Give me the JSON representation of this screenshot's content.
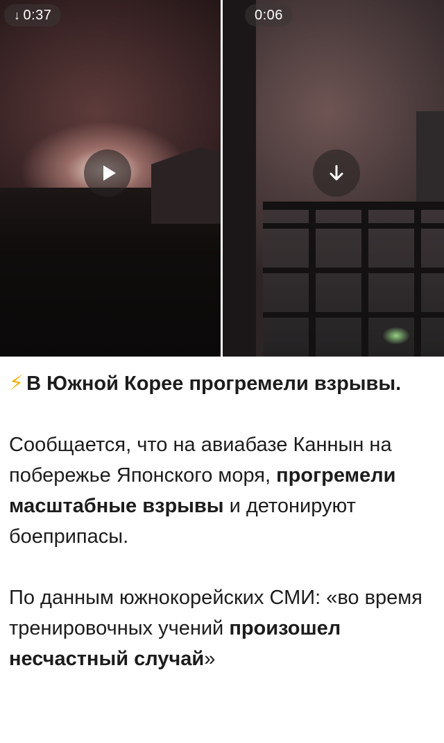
{
  "videos": [
    {
      "duration": "0:37",
      "has_download_arrow": true,
      "center_icon": "play-icon",
      "badge_icon": "download-arrow-icon"
    },
    {
      "duration": "0:06",
      "has_download_arrow": false,
      "center_icon": "download-arrow-icon"
    }
  ],
  "icons": {
    "bolt": "⚡",
    "download_arrow": "↓"
  },
  "post": {
    "headline": "В Южной Корее прогремели взрывы.",
    "p1_part1": "Сообщается, что на авиабазе Каннын на побережье Японского моря, ",
    "p1_bold": "прогремели масштабные взрывы",
    "p1_part2": " и детонируют боеприпасы.",
    "p2_part1": "По данным южнокорейских СМИ: «во время тренировочных учений ",
    "p2_bold": "произошел несчастный случай",
    "p2_part2": "»"
  },
  "colors": {
    "bolt": "#f4b400",
    "text": "#1c1c1c",
    "badge_bg": "rgba(60,55,55,0.55)"
  }
}
